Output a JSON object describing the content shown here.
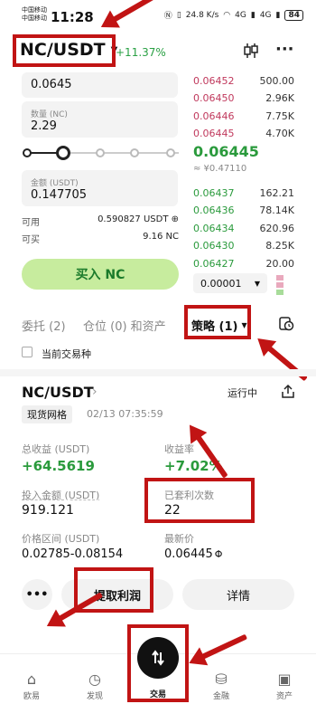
{
  "status_bar": {
    "carrier_1": "中国移动",
    "carrier_2": "中国移动",
    "time": "11:28",
    "speed": "24.8 K/s",
    "signal_1": "4G",
    "signal_2": "4G",
    "battery": "84"
  },
  "header": {
    "pair": "NC/USDT",
    "change": "+11.37%"
  },
  "form": {
    "price_value": "0.0645",
    "amount_label": "数量 (NC)",
    "amount_value": "2.29",
    "total_label": "金额 (USDT)",
    "total_value": "0.147705",
    "available_label": "可用",
    "available_value": "0.590827 USDT ⊕",
    "buyable_label": "可买",
    "buyable_value": "9.16 NC",
    "buy_button": "买入 NC"
  },
  "orderbook": {
    "asks": [
      {
        "price": "0.06452",
        "qty": "500.00",
        "depth": 0.12
      },
      {
        "price": "0.06450",
        "qty": "2.96K",
        "depth": 0.08
      },
      {
        "price": "0.06446",
        "qty": "7.75K",
        "depth": 0.06
      },
      {
        "price": "0.06445",
        "qty": "4.70K",
        "depth": 0.05
      }
    ],
    "last_price": "0.06445",
    "last_fiat": "≈ ¥0.47110",
    "bids": [
      {
        "price": "0.06437",
        "qty": "162.21",
        "depth": 0.0
      },
      {
        "price": "0.06436",
        "qty": "78.14K",
        "depth": 1.0
      },
      {
        "price": "0.06434",
        "qty": "620.96",
        "depth": 0.06
      },
      {
        "price": "0.06430",
        "qty": "8.25K",
        "depth": 0.07
      },
      {
        "price": "0.06427",
        "qty": "20.00",
        "depth": 0.0
      }
    ],
    "precision": "0.00001"
  },
  "tabs": {
    "orders": "委托 (2)",
    "positions": "仓位 (0) 和资产",
    "strategy": "策略 (1)",
    "current_only": "当前交易种"
  },
  "strategy_card": {
    "pair": "NC/USDT",
    "status": "运行中",
    "type": "现货网格",
    "time": "02/13 07:35:59",
    "total_profit_label": "总收益 (USDT)",
    "total_profit_value": "+64.5619",
    "yield_label": "收益率",
    "yield_value": "+7.02%",
    "invest_label": "投入金额 (USDT)",
    "invest_value": "919.121",
    "arbitrage_label": "已套利次数",
    "arbitrage_value": "22",
    "range_label": "价格区间 (USDT)",
    "range_value": "0.02785-0.08154",
    "latest_label": "最新价",
    "latest_value": "0.06445",
    "more_label": "•••",
    "withdraw_label": "提取利润",
    "detail_label": "详情"
  },
  "bottom_nav": {
    "home": "欧易",
    "discover": "发现",
    "trade": "交易",
    "finance": "金融",
    "assets": "资产"
  },
  "colors": {
    "annotation_red": "#c11414",
    "up_green": "#2a9a3c",
    "down_red": "#c0385c",
    "buy_button": "#c7ec9e"
  }
}
